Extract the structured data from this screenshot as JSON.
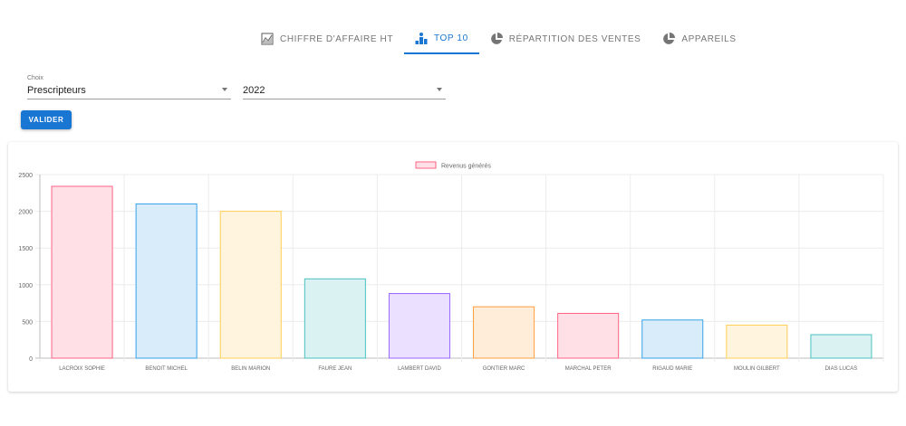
{
  "tabs": [
    {
      "label": "CHIFFRE D'AFFAIRE HT",
      "icon": "area-chart-icon",
      "active": false
    },
    {
      "label": "TOP 10",
      "icon": "podium-icon",
      "active": true
    },
    {
      "label": "RÉPARTITION DES VENTES",
      "icon": "pie-chart-icon",
      "active": false
    },
    {
      "label": "APPAREILS",
      "icon": "pie-chart-icon",
      "active": false
    }
  ],
  "form": {
    "choice_label": "Choix",
    "choice_value": "Prescripteurs",
    "year_value": "2022",
    "submit_label": "VALIDER"
  },
  "colors": {
    "accent": "#1976d2",
    "bar_fills": [
      "#ffe0e6",
      "#d9ecf9",
      "#fff4dd",
      "#dbf2f2",
      "#ebe0ff",
      "#ffecd9",
      "#ffe0e6",
      "#d9ecf9",
      "#fff4dd",
      "#dbf2f2"
    ],
    "bar_strokes": [
      "#ff6384",
      "#36a2eb",
      "#ffce56",
      "#4bc0c0",
      "#9966ff",
      "#ff9f40",
      "#ff6384",
      "#36a2eb",
      "#ffce56",
      "#4bc0c0"
    ]
  },
  "chart_data": {
    "type": "bar",
    "legend": "Revenus générés",
    "legend_position": "top-center",
    "grid": true,
    "ylim": [
      0,
      2500
    ],
    "yticks": [
      "0",
      "500",
      "1000",
      "1500",
      "2000",
      "2500"
    ],
    "categories": [
      "LACROIX SOPHIE",
      "BENOIT MICHEL",
      "BELIN MARION",
      "FAURE JEAN",
      "LAMBERT DAVID",
      "GONTIER MARC",
      "MARCHAL PETER",
      "RIGAUD MARIE",
      "MOULIN GILBERT",
      "DIAS LUCAS"
    ],
    "values": [
      2340,
      2100,
      2000,
      1080,
      880,
      700,
      610,
      520,
      450,
      320
    ]
  }
}
